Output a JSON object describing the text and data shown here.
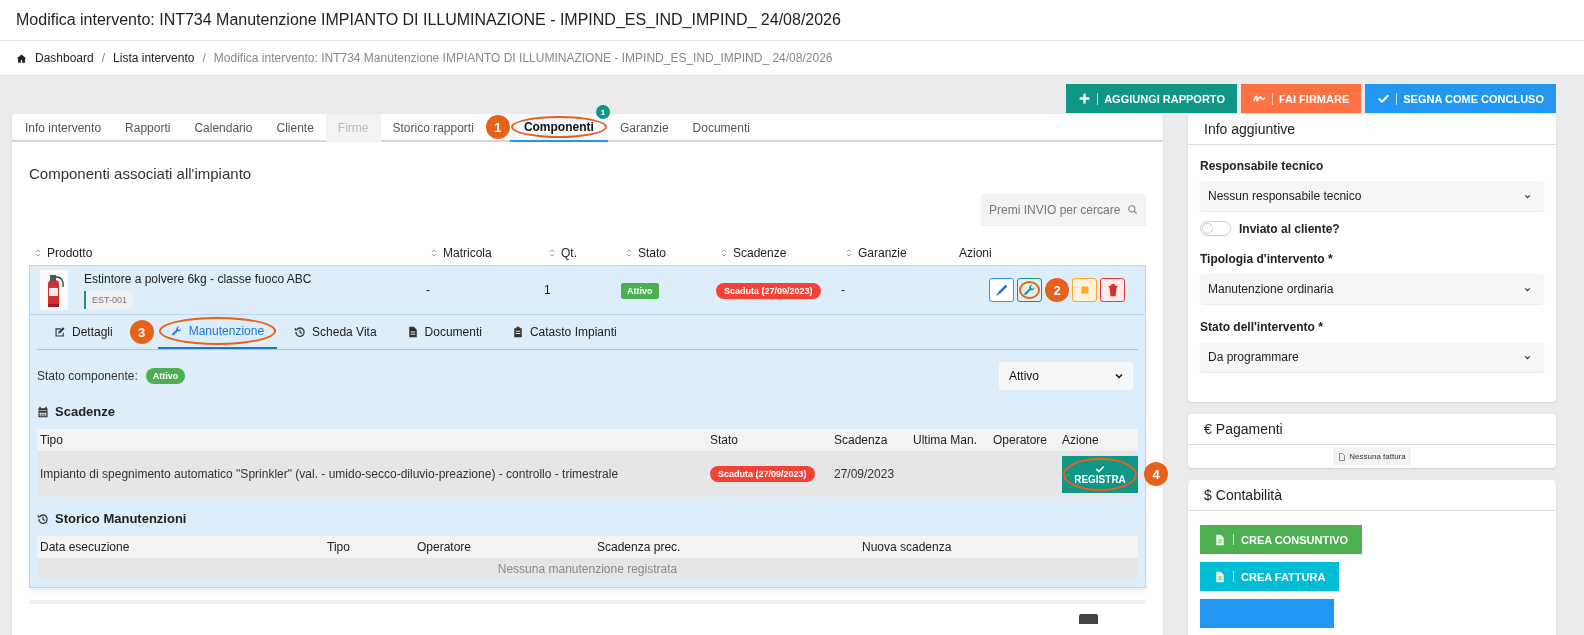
{
  "page_title": "Modifica intervento: INT734 Manutenzione IMPIANTO DI ILLUMINAZIONE - IMPIND_ES_IND_IMPIND_ 24/08/2026",
  "breadcrumb_separator": "/",
  "breadcrumb": [
    {
      "label": "Dashboard",
      "link": true
    },
    {
      "label": "Lista intervento",
      "link": true
    },
    {
      "label": "Modifica intervento: INT734 Manutenzione IMPIANTO DI ILLUMINAZIONE - IMPIND_ES_IND_IMPIND_ 24/08/2026",
      "link": false
    }
  ],
  "actions": [
    {
      "label": "AGGIUNGI RAPPORTO",
      "kind": "add"
    },
    {
      "label": "FAI FIRMARE",
      "kind": "sign"
    },
    {
      "label": "SEGNA COME CONCLUSO",
      "kind": "done"
    }
  ],
  "tabs": [
    {
      "label": "Info intervento",
      "selected": false,
      "disabled": false
    },
    {
      "label": "Rapporti",
      "selected": false,
      "disabled": false
    },
    {
      "label": "Calendario",
      "selected": false,
      "disabled": false
    },
    {
      "label": "Cliente",
      "selected": false,
      "disabled": false
    },
    {
      "label": "Firme",
      "selected": false,
      "disabled": true
    },
    {
      "label": "Storico rapporti",
      "selected": false,
      "disabled": false
    },
    {
      "label": "Componenti",
      "selected": true,
      "disabled": false,
      "count": "1",
      "callout": "1"
    },
    {
      "label": "Garanzie",
      "selected": false,
      "disabled": false
    },
    {
      "label": "Documenti",
      "selected": false,
      "disabled": false
    }
  ],
  "components": {
    "title": "Componenti associati all'impianto",
    "search": {
      "placeholder": "Premi INVIO per cercare"
    },
    "columns": [
      {
        "label": "Prodotto",
        "sortable": true
      },
      {
        "label": "Matricola",
        "sortable": true
      },
      {
        "label": "Qt.",
        "sortable": true
      },
      {
        "label": "Stato",
        "sortable": true
      },
      {
        "label": "Scadenze",
        "sortable": true
      },
      {
        "label": "Garanzie",
        "sortable": true
      },
      {
        "label": "Azioni",
        "sortable": false
      }
    ],
    "rows": [
      {
        "name": "Estintore a polvere 6kg - classe fuoco ABC",
        "code": "EST-001",
        "thumbnail": {
          "kind": "picture"
        },
        "serial": "-",
        "qty": "1",
        "status": {
          "label": "Attivo",
          "kind": "active"
        },
        "deadline": {
          "label": "Scaduta (27/09/2023)",
          "kind": "expired"
        },
        "warranty": "-",
        "expanded": true,
        "actions": [
          {
            "kind": "edit"
          },
          {
            "kind": "maintenance",
            "callout": "2"
          },
          {
            "kind": "other"
          },
          {
            "kind": "delete"
          }
        ]
      }
    ]
  },
  "detail": {
    "tabs": [
      {
        "label": "Dettagli",
        "kind": "edit",
        "selected": false
      },
      {
        "label": "Manutenzione",
        "kind": "wrench",
        "selected": true,
        "callout": "3"
      },
      {
        "label": "Scheda Vita",
        "kind": "history",
        "selected": false
      },
      {
        "label": "Documenti",
        "kind": "file",
        "selected": false
      },
      {
        "label": "Catasto Impianti",
        "kind": "clipboard",
        "selected": false
      }
    ],
    "state_label": "Stato componente:",
    "state_badge": {
      "label": "Attivo",
      "kind": "active"
    },
    "state_select": {
      "value": "Attivo"
    },
    "deadlines": {
      "title": "Scadenze",
      "columns": [
        "Tipo",
        "Stato",
        "Scadenza",
        "Ultima Man.",
        "Operatore",
        "Azione"
      ],
      "rows": [
        {
          "type": "Impianto di spegnimento automatico \"Sprinkler\" (val. - umido-secco-diluvio-preazione) - controllo - trimestrale",
          "status": {
            "label": "Scaduta (27/09/2023)",
            "kind": "expired"
          },
          "due": "27/09/2023",
          "action": {
            "label": "REGISTRA",
            "callout": "4"
          }
        }
      ]
    },
    "history": {
      "title": "Storico Manutenzioni",
      "columns": [
        "Data esecuzione",
        "Tipo",
        "Operatore",
        "Scadenza prec.",
        "Nuova scadenza"
      ],
      "empty": "Nessuna manutenzione registrata"
    }
  },
  "side": {
    "info": {
      "title": "Info aggiuntive",
      "fields": [
        {
          "kind": "select",
          "label": "Responsabile tecnico",
          "value": "Nessun responsabile tecnico"
        },
        {
          "kind": "toggle",
          "label": "Inviato al cliente?",
          "on": false
        },
        {
          "kind": "select",
          "label": "Tipologia d'intervento *",
          "value": "Manutenzione ordinaria"
        },
        {
          "kind": "select",
          "label": "Stato dell'intervento *",
          "value": "Da programmare"
        }
      ]
    },
    "payments": {
      "icon": "€",
      "title": "Pagamenti",
      "empty": "Nessuna fattura"
    },
    "accounting": {
      "icon": "$",
      "title": "Contabilità",
      "buttons": [
        {
          "label": "CREA CONSUNTIVO",
          "color": "#4caf50"
        },
        {
          "label": "CREA FATTURA",
          "color": "#00bcd4"
        },
        {
          "color": "#2196f3"
        }
      ]
    }
  }
}
